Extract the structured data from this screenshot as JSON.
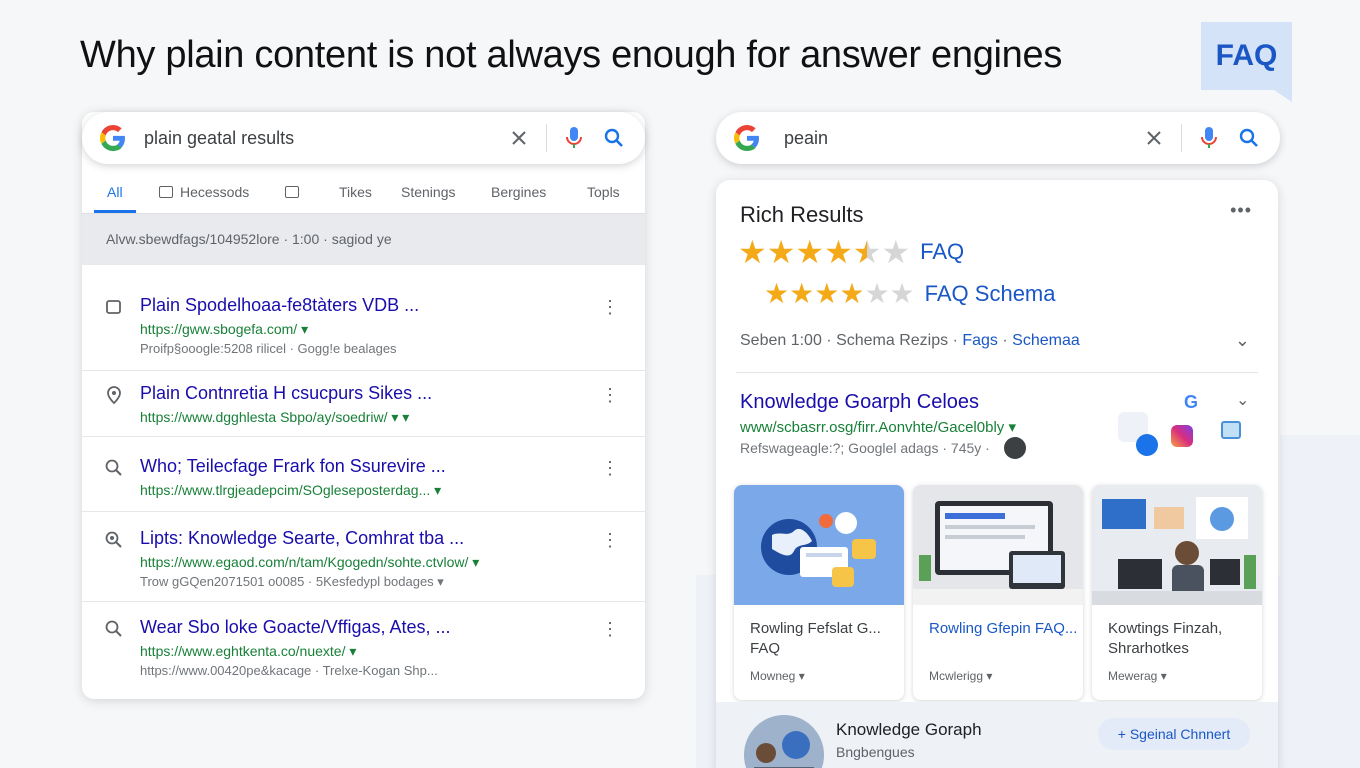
{
  "headline": "Why plain content is not always enough for answer engines",
  "badge": "FAQ",
  "left": {
    "query": "plain geatal results",
    "tabs": [
      "All",
      "Hecessods",
      "Tikes",
      "Stenings",
      "Bergines",
      "Topls"
    ],
    "url_strip": "Alvw.sbewdfags/104952lore · 1:00 · sagiod ye",
    "results": [
      {
        "title": "Plain Spodelhoaa-fe8tàters VDB ...",
        "url": "https://gww.sbogefa.com/ ▾",
        "meta": "Proifp§ooogle:5208 rilicel · Gogg!e bealages",
        "icon": "square-icon"
      },
      {
        "title": "Plain Contnretia H csucpurs Sikes ...",
        "url": "https://www.dgghlesta Sbpo/ay/soedriw/ ▾  ▾",
        "meta": "",
        "icon": "location-pin-icon"
      },
      {
        "title": "Who; Teilecfage Frark fon Ssurevire ...",
        "url": "https://www.tlrgjeadepcim/SOgleseposterdag... ▾",
        "meta": "",
        "icon": "search-icon"
      },
      {
        "title": "Lipts: Knowledge Searte, Comhrat tba ...",
        "url": "https://www.egaod.com/n/tam/Kgogedn/sohte.ctvlow/ ▾",
        "meta": "Trow gGQen2071501 o0085 · 5Kesfedypl bodages ▾",
        "icon": "zoom-icon"
      },
      {
        "title": "Wear Sbo loke Goacte/Vffigas, Ates, ...",
        "url": "https://www.eghtkenta.co/nuexte/ ▾",
        "meta": "https://www.00420pe&kacage · Trelxe-Kogan Shp...",
        "icon": "search-icon"
      }
    ]
  },
  "right": {
    "query": "peain",
    "panel_title": "Rich Results",
    "rating1": {
      "value": 4.5,
      "label": "FAQ"
    },
    "rating2": {
      "value": 4,
      "label": "FAQ  Schema"
    },
    "meta_plain": "Seben 1:00 · Schema Rezips · ",
    "meta_link1": "Fags",
    "meta_sep": " · ",
    "meta_link2": "Schemaa",
    "kg_title": "Knowledge Goarph Celoes",
    "kg_url": "www/scbasrr.osg/firr.Aonvhte/Gacel0bly ▾",
    "kg_meta": "Refswageagle:?; Googlel adags · 745y ·",
    "cards": [
      {
        "title": "Rowling Fefslat G... FAQ",
        "meta": "Mowneg ▾"
      },
      {
        "title": "Rowling Gfepin FAQ...",
        "meta": "Mcwlerigg ▾"
      },
      {
        "title": "Kowtings Finzah, Shrarhotkes",
        "meta": "Mewerag ▾"
      }
    ],
    "kg2_title": "Knowledge Goraph",
    "kg2_sub": "Bngbengues",
    "pill": "+ Sgeinal Chnnert"
  },
  "colors": {
    "link": "#1a0dab",
    "url": "#188038",
    "accent": "#1a73e8",
    "star": "#f4a919"
  }
}
